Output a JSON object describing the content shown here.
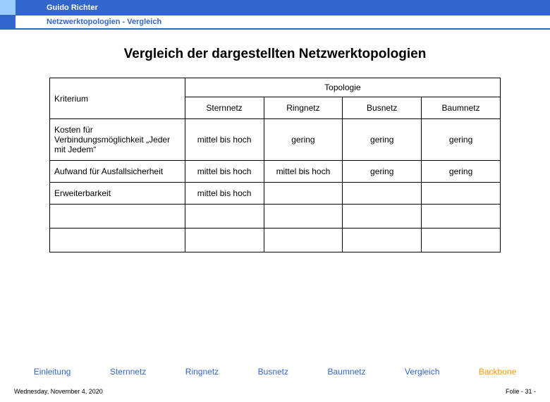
{
  "author": "Guido Richter",
  "subtitle": "Netzwerktopologien  - Vergleich",
  "title": "Vergleich der dargestellten Netzwerktopologien",
  "table": {
    "criterion_label": "Kriterium",
    "topology_label": "Topologie",
    "columns": [
      "Sternnetz",
      "Ringnetz",
      "Busnetz",
      "Baumnetz"
    ],
    "rows": [
      {
        "crit": "Kosten für Verbindungsmöglichkeit „Jeder mit Jedem“",
        "v": [
          "mittel bis hoch",
          "gering",
          "gering",
          "gering"
        ]
      },
      {
        "crit": "Aufwand für Ausfallsicherheit",
        "v": [
          "mittel bis hoch",
          "mittel bis hoch",
          "gering",
          "gering"
        ]
      },
      {
        "crit": "Erweiterbarkeit",
        "v": [
          "mittel bis hoch",
          "",
          "",
          ""
        ]
      },
      {
        "crit": "",
        "v": [
          "",
          "",
          "",
          ""
        ]
      },
      {
        "crit": "",
        "v": [
          "",
          "",
          "",
          ""
        ]
      }
    ]
  },
  "nav": {
    "items": [
      "Einleitung",
      "Sternnetz",
      "Ringnetz",
      "Busnetz",
      "Baumnetz",
      "Vergleich",
      "Backbone"
    ],
    "active_index": 6
  },
  "footer": {
    "date": "Wednesday, November 4, 2020",
    "page": "Folie - 31 -"
  }
}
